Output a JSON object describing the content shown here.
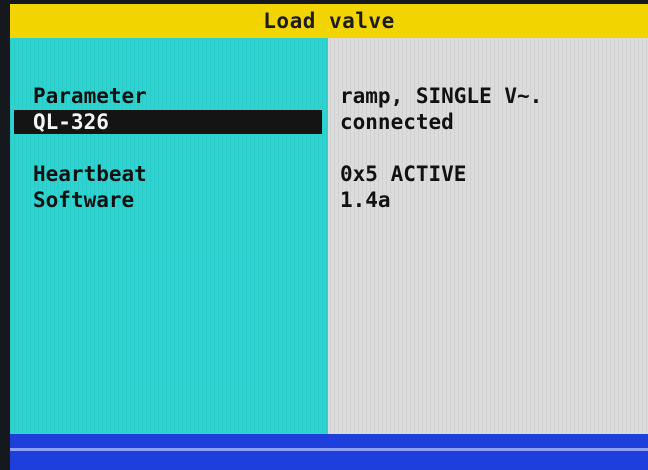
{
  "title": "Load valve",
  "rows": [
    {
      "label": "Parameter",
      "value": "ramp, SINGLE V~."
    },
    {
      "label": "QL-326",
      "value": "connected"
    },
    {
      "label": "Heartbeat",
      "value": "0x5 ACTIVE"
    },
    {
      "label": "Software",
      "value": "1.4a"
    }
  ],
  "colors": {
    "title_bar": "#f2d400",
    "left_panel": "#2dd5d2",
    "right_panel": "#dcdcdc",
    "selection": "#141414",
    "status_bar": "#1f3fdc"
  }
}
